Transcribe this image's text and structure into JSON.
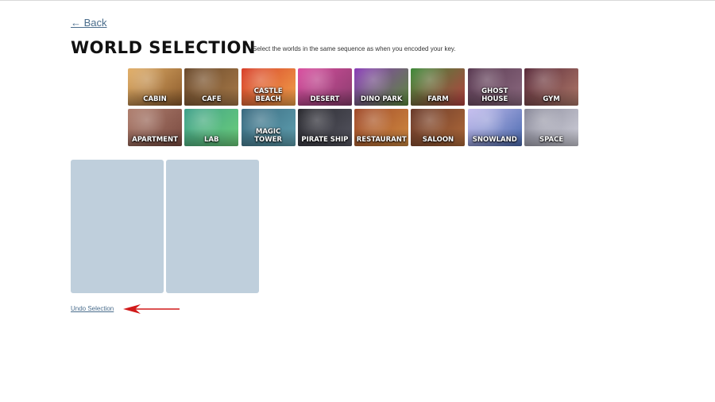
{
  "nav": {
    "back_label": "← Back"
  },
  "page": {
    "title": "WORLD SELECTION",
    "instructions": "Select the worlds in the same sequence as when you encoded your key."
  },
  "worlds": [
    {
      "label": "CABIN",
      "colors": [
        "#e2b06a",
        "#8b5a2b"
      ]
    },
    {
      "label": "CAFE",
      "colors": [
        "#6b4a2c",
        "#a87a48"
      ]
    },
    {
      "label": "CASTLE\nBEACH",
      "colors": [
        "#d8402a",
        "#f0a24a"
      ]
    },
    {
      "label": "DESERT",
      "colors": [
        "#d94fa0",
        "#8a3d6e"
      ]
    },
    {
      "label": "DINO PARK",
      "colors": [
        "#8a3cb8",
        "#5b8a3a"
      ]
    },
    {
      "label": "FARM",
      "colors": [
        "#3f8a3a",
        "#b64040"
      ]
    },
    {
      "label": "GHOST\nHOUSE",
      "colors": [
        "#5a3a52",
        "#8c6a80"
      ]
    },
    {
      "label": "GYM",
      "colors": [
        "#5a2a3a",
        "#b07a6a"
      ]
    },
    {
      "label": "APARTMENT",
      "colors": [
        "#b08070",
        "#7a4a40"
      ]
    },
    {
      "label": "LAB",
      "colors": [
        "#3fa08a",
        "#6ccf7a"
      ]
    },
    {
      "label": "MAGIC\nTOWER",
      "colors": [
        "#3a6a80",
        "#5fa0b0"
      ]
    },
    {
      "label": "PIRATE SHIP",
      "colors": [
        "#2a2a30",
        "#555560"
      ]
    },
    {
      "label": "RESTAURANT",
      "colors": [
        "#a04a2a",
        "#d08a40"
      ]
    },
    {
      "label": "SALOON",
      "colors": [
        "#6a3a2a",
        "#b06a3a"
      ]
    },
    {
      "label": "SNOWLAND",
      "colors": [
        "#c8c0f0",
        "#4a6ab0"
      ]
    },
    {
      "label": "SPACE",
      "colors": [
        "#8a8a9a",
        "#d0d0da"
      ]
    }
  ],
  "slots": [
    {
      "state": "empty"
    },
    {
      "state": "empty"
    }
  ],
  "actions": {
    "undo_label": "Undo Selection"
  },
  "annotation": {
    "arrow_color": "#d11a1a"
  }
}
